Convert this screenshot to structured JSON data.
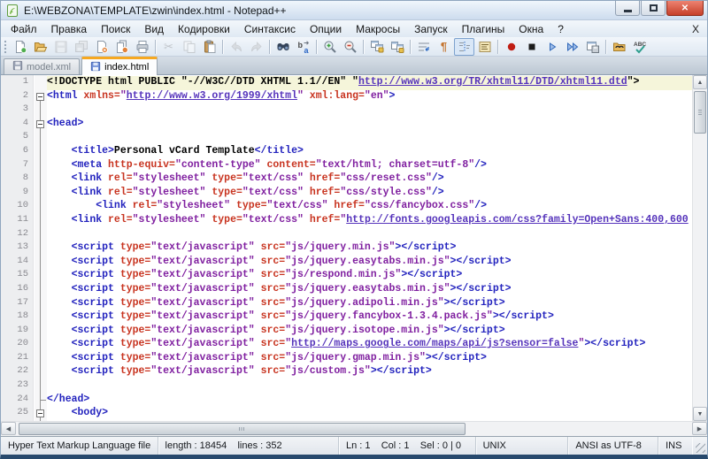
{
  "window": {
    "title": "E:\\WEBZONA\\TEMPLATE\\zwin\\index.html - Notepad++"
  },
  "menu_bar": {
    "items": [
      "Файл",
      "Правка",
      "Поиск",
      "Вид",
      "Кодировки",
      "Синтаксис",
      "Опции",
      "Макросы",
      "Запуск",
      "Плагины",
      "Окна",
      "?"
    ],
    "right_close": "X"
  },
  "toolbar": {
    "buttons": [
      {
        "name": "new-file-icon"
      },
      {
        "name": "open-file-icon"
      },
      {
        "name": "save-icon",
        "disabled": true
      },
      {
        "name": "save-all-icon",
        "disabled": true
      },
      {
        "name": "close-file-icon"
      },
      {
        "name": "close-all-icon"
      },
      {
        "name": "print-icon"
      },
      {
        "sep": true
      },
      {
        "name": "cut-icon",
        "disabled": true
      },
      {
        "name": "copy-icon",
        "disabled": true
      },
      {
        "name": "paste-icon"
      },
      {
        "sep": true
      },
      {
        "name": "undo-icon",
        "disabled": true
      },
      {
        "name": "redo-icon",
        "disabled": true
      },
      {
        "sep": true
      },
      {
        "name": "find-icon"
      },
      {
        "name": "replace-icon"
      },
      {
        "sep": true
      },
      {
        "name": "zoom-in-icon"
      },
      {
        "name": "zoom-out-icon"
      },
      {
        "sep": true
      },
      {
        "name": "sync-vertical-icon"
      },
      {
        "name": "sync-horizontal-icon"
      },
      {
        "sep": true
      },
      {
        "name": "word-wrap-icon"
      },
      {
        "name": "show-all-chars-icon"
      },
      {
        "name": "indent-guide-icon",
        "pressed": true
      },
      {
        "name": "function-list-icon"
      },
      {
        "sep": true
      },
      {
        "name": "macro-record-icon"
      },
      {
        "name": "macro-stop-icon"
      },
      {
        "name": "macro-play-icon"
      },
      {
        "name": "macro-run-multi-icon"
      },
      {
        "name": "macro-save-icon"
      },
      {
        "sep": true
      },
      {
        "name": "plugin-mime-icon"
      },
      {
        "name": "spell-check-icon"
      }
    ]
  },
  "tab_bar": {
    "tabs": [
      {
        "label": "model.xml",
        "active": false
      },
      {
        "label": "index.html",
        "active": true
      }
    ]
  },
  "editor": {
    "current_line": 1,
    "lines": [
      {
        "fold": "",
        "tokens": [
          [
            "text",
            "<!DOCTYPE html PUBLIC \"-//W3C//DTD XHTML 1.1//EN\" \""
          ],
          [
            "link",
            "http://www.w3.org/TR/xhtml11/DTD/xhtml11.dtd"
          ],
          [
            "text",
            "\">"
          ]
        ]
      },
      {
        "fold": "box-first",
        "tokens": [
          [
            "tag",
            "<html"
          ],
          [
            "text",
            " "
          ],
          [
            "attr",
            "xmlns="
          ],
          [
            "val",
            "\""
          ],
          [
            "link",
            "http://www.w3.org/1999/xhtml"
          ],
          [
            "val",
            "\""
          ],
          [
            "text",
            " "
          ],
          [
            "attr",
            "xml:lang="
          ],
          [
            "val",
            "\"en\""
          ],
          [
            "tag",
            ">"
          ]
        ]
      },
      {
        "fold": "line",
        "tokens": []
      },
      {
        "fold": "box-mid",
        "tokens": [
          [
            "tag",
            "<head>"
          ]
        ]
      },
      {
        "fold": "line",
        "tokens": []
      },
      {
        "fold": "line",
        "tokens": [
          [
            "text",
            "    "
          ],
          [
            "tag",
            "<title>"
          ],
          [
            "text",
            "Personal vCard Template"
          ],
          [
            "tag",
            "</title>"
          ]
        ]
      },
      {
        "fold": "line",
        "tokens": [
          [
            "text",
            "    "
          ],
          [
            "tag",
            "<meta"
          ],
          [
            "text",
            " "
          ],
          [
            "attr",
            "http-equiv="
          ],
          [
            "val",
            "\"content-type\""
          ],
          [
            "text",
            " "
          ],
          [
            "attr",
            "content="
          ],
          [
            "val",
            "\"text/html; charset=utf-8\""
          ],
          [
            "tag",
            "/>"
          ]
        ]
      },
      {
        "fold": "line",
        "tokens": [
          [
            "text",
            "    "
          ],
          [
            "tag",
            "<link"
          ],
          [
            "text",
            " "
          ],
          [
            "attr",
            "rel="
          ],
          [
            "val",
            "\"stylesheet\""
          ],
          [
            "text",
            " "
          ],
          [
            "attr",
            "type="
          ],
          [
            "val",
            "\"text/css\""
          ],
          [
            "text",
            " "
          ],
          [
            "attr",
            "href="
          ],
          [
            "val",
            "\"css/reset.css\""
          ],
          [
            "tag",
            "/>"
          ]
        ]
      },
      {
        "fold": "line",
        "tokens": [
          [
            "text",
            "    "
          ],
          [
            "tag",
            "<link"
          ],
          [
            "text",
            " "
          ],
          [
            "attr",
            "rel="
          ],
          [
            "val",
            "\"stylesheet\""
          ],
          [
            "text",
            " "
          ],
          [
            "attr",
            "type="
          ],
          [
            "val",
            "\"text/css\""
          ],
          [
            "text",
            " "
          ],
          [
            "attr",
            "href="
          ],
          [
            "val",
            "\"css/style.css\""
          ],
          [
            "tag",
            "/>"
          ]
        ]
      },
      {
        "fold": "line",
        "tokens": [
          [
            "text",
            "        "
          ],
          [
            "tag",
            "<link"
          ],
          [
            "text",
            " "
          ],
          [
            "attr",
            "rel="
          ],
          [
            "val",
            "\"stylesheet\""
          ],
          [
            "text",
            " "
          ],
          [
            "attr",
            "type="
          ],
          [
            "val",
            "\"text/css\""
          ],
          [
            "text",
            " "
          ],
          [
            "attr",
            "href="
          ],
          [
            "val",
            "\"css/fancybox.css\""
          ],
          [
            "tag",
            "/>"
          ]
        ]
      },
      {
        "fold": "line",
        "tokens": [
          [
            "text",
            "    "
          ],
          [
            "tag",
            "<link"
          ],
          [
            "text",
            " "
          ],
          [
            "attr",
            "rel="
          ],
          [
            "val",
            "\"stylesheet\""
          ],
          [
            "text",
            " "
          ],
          [
            "attr",
            "type="
          ],
          [
            "val",
            "\"text/css\""
          ],
          [
            "text",
            " "
          ],
          [
            "attr",
            "href="
          ],
          [
            "val",
            "\""
          ],
          [
            "link",
            "http://fonts.googleapis.com/css?family=Open+Sans:400,600"
          ]
        ]
      },
      {
        "fold": "line",
        "tokens": []
      },
      {
        "fold": "line",
        "tokens": [
          [
            "text",
            "    "
          ],
          [
            "tag",
            "<script"
          ],
          [
            "text",
            " "
          ],
          [
            "attr",
            "type="
          ],
          [
            "val",
            "\"text/javascript\""
          ],
          [
            "text",
            " "
          ],
          [
            "attr",
            "src="
          ],
          [
            "val",
            "\"js/jquery.min.js\""
          ],
          [
            "tag",
            "></script>"
          ]
        ]
      },
      {
        "fold": "line",
        "tokens": [
          [
            "text",
            "    "
          ],
          [
            "tag",
            "<script"
          ],
          [
            "text",
            " "
          ],
          [
            "attr",
            "type="
          ],
          [
            "val",
            "\"text/javascript\""
          ],
          [
            "text",
            " "
          ],
          [
            "attr",
            "src="
          ],
          [
            "val",
            "\"js/jquery.easytabs.min.js\""
          ],
          [
            "tag",
            "></script>"
          ]
        ]
      },
      {
        "fold": "line",
        "tokens": [
          [
            "text",
            "    "
          ],
          [
            "tag",
            "<script"
          ],
          [
            "text",
            " "
          ],
          [
            "attr",
            "type="
          ],
          [
            "val",
            "\"text/javascript\""
          ],
          [
            "text",
            " "
          ],
          [
            "attr",
            "src="
          ],
          [
            "val",
            "\"js/respond.min.js\""
          ],
          [
            "tag",
            "></script>"
          ]
        ]
      },
      {
        "fold": "line",
        "tokens": [
          [
            "text",
            "    "
          ],
          [
            "tag",
            "<script"
          ],
          [
            "text",
            " "
          ],
          [
            "attr",
            "type="
          ],
          [
            "val",
            "\"text/javascript\""
          ],
          [
            "text",
            " "
          ],
          [
            "attr",
            "src="
          ],
          [
            "val",
            "\"js/jquery.easytabs.min.js\""
          ],
          [
            "tag",
            "></script>"
          ]
        ]
      },
      {
        "fold": "line",
        "tokens": [
          [
            "text",
            "    "
          ],
          [
            "tag",
            "<script"
          ],
          [
            "text",
            " "
          ],
          [
            "attr",
            "type="
          ],
          [
            "val",
            "\"text/javascript\""
          ],
          [
            "text",
            " "
          ],
          [
            "attr",
            "src="
          ],
          [
            "val",
            "\"js/jquery.adipoli.min.js\""
          ],
          [
            "tag",
            "></script>"
          ]
        ]
      },
      {
        "fold": "line",
        "tokens": [
          [
            "text",
            "    "
          ],
          [
            "tag",
            "<script"
          ],
          [
            "text",
            " "
          ],
          [
            "attr",
            "type="
          ],
          [
            "val",
            "\"text/javascript\""
          ],
          [
            "text",
            " "
          ],
          [
            "attr",
            "src="
          ],
          [
            "val",
            "\"js/jquery.fancybox-1.3.4.pack.js\""
          ],
          [
            "tag",
            "></script>"
          ]
        ]
      },
      {
        "fold": "line",
        "tokens": [
          [
            "text",
            "    "
          ],
          [
            "tag",
            "<script"
          ],
          [
            "text",
            " "
          ],
          [
            "attr",
            "type="
          ],
          [
            "val",
            "\"text/javascript\""
          ],
          [
            "text",
            " "
          ],
          [
            "attr",
            "src="
          ],
          [
            "val",
            "\"js/jquery.isotope.min.js\""
          ],
          [
            "tag",
            "></script>"
          ]
        ]
      },
      {
        "fold": "line",
        "tokens": [
          [
            "text",
            "    "
          ],
          [
            "tag",
            "<script"
          ],
          [
            "text",
            " "
          ],
          [
            "attr",
            "type="
          ],
          [
            "val",
            "\"text/javascript\""
          ],
          [
            "text",
            " "
          ],
          [
            "attr",
            "src="
          ],
          [
            "val",
            "\""
          ],
          [
            "link",
            "http://maps.google.com/maps/api/js?sensor=false"
          ],
          [
            "val",
            "\""
          ],
          [
            "tag",
            "></script>"
          ]
        ]
      },
      {
        "fold": "line",
        "tokens": [
          [
            "text",
            "    "
          ],
          [
            "tag",
            "<script"
          ],
          [
            "text",
            " "
          ],
          [
            "attr",
            "type="
          ],
          [
            "val",
            "\"text/javascript\""
          ],
          [
            "text",
            " "
          ],
          [
            "attr",
            "src="
          ],
          [
            "val",
            "\"js/jquery.gmap.min.js\""
          ],
          [
            "tag",
            "></script>"
          ]
        ]
      },
      {
        "fold": "line",
        "tokens": [
          [
            "text",
            "    "
          ],
          [
            "tag",
            "<script"
          ],
          [
            "text",
            " "
          ],
          [
            "attr",
            "type="
          ],
          [
            "val",
            "\"text/javascript\""
          ],
          [
            "text",
            " "
          ],
          [
            "attr",
            "src="
          ],
          [
            "val",
            "\"js/custom.js\""
          ],
          [
            "tag",
            "></script>"
          ]
        ]
      },
      {
        "fold": "line",
        "tokens": []
      },
      {
        "fold": "tee",
        "tokens": [
          [
            "tag",
            "</head>"
          ]
        ]
      },
      {
        "fold": "box-mid",
        "tokens": [
          [
            "text",
            "    "
          ],
          [
            "tag",
            "<body>"
          ]
        ]
      }
    ]
  },
  "status_bar": {
    "doc_type": "Hyper Text Markup Language file",
    "length_lines": "length : 18454    lines : 352",
    "position": "Ln : 1    Col : 1    Sel : 0 | 0",
    "eol": "UNIX",
    "encoding": "ANSI as UTF-8",
    "mode": "INS"
  }
}
